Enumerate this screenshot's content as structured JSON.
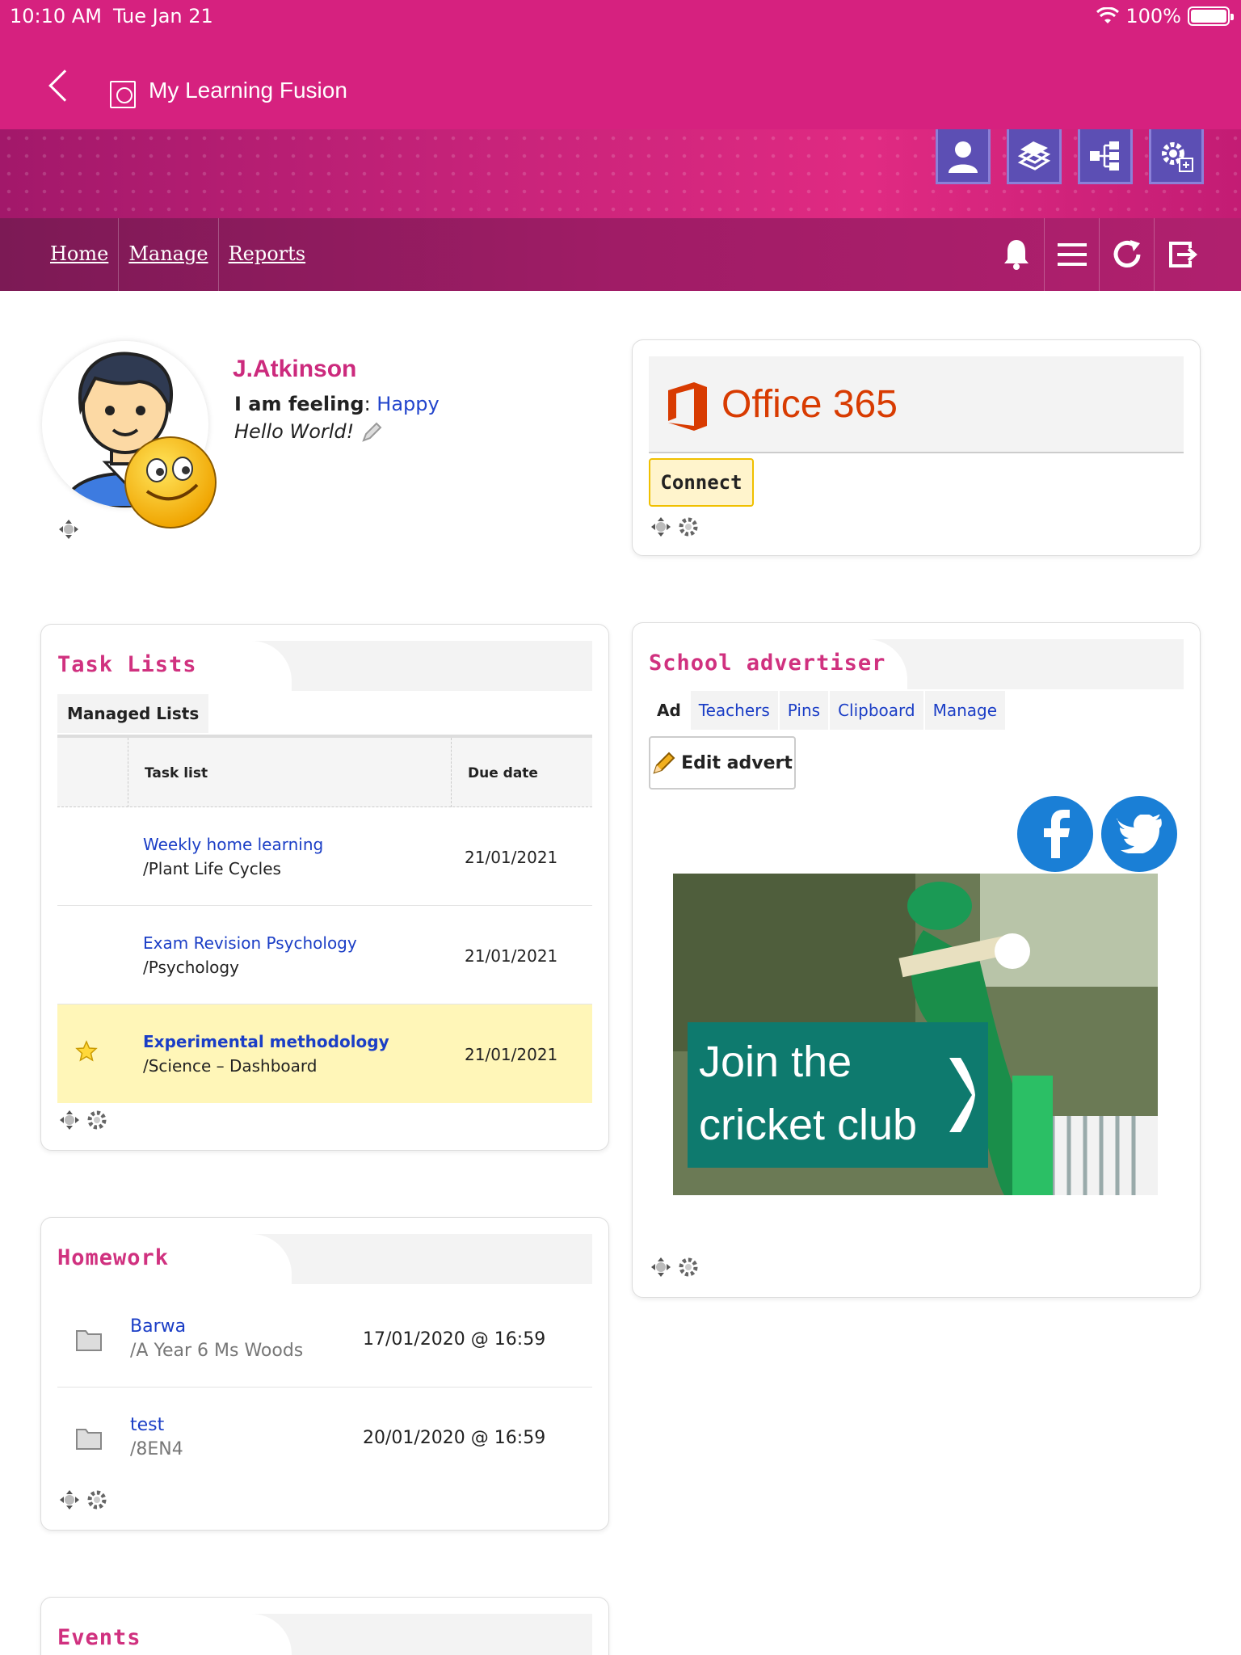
{
  "status_bar": {
    "time": "10:10 AM",
    "date": "Tue Jan 21",
    "battery": "100%"
  },
  "app": {
    "title": "My Learning Fusion"
  },
  "nav": {
    "links": [
      "Home",
      "Manage",
      "Reports"
    ]
  },
  "top_buttons": [
    "user-icon",
    "books-icon",
    "hierarchy-icon",
    "settings-icon"
  ],
  "nav_icons": [
    "bell-icon",
    "menu-icon",
    "refresh-icon",
    "logout-icon"
  ],
  "profile": {
    "name": "J.Atkinson",
    "feeling_label": "I am feeling",
    "feeling_value": "Happy",
    "status": "Hello World!"
  },
  "office": {
    "brand": "Office 365",
    "connect_label": "Connect"
  },
  "task_lists": {
    "title": "Task Lists",
    "subtab": "Managed Lists",
    "columns": [
      "Task list",
      "Due date"
    ],
    "rows": [
      {
        "name": "Weekly home learning",
        "path": "/Plant Life Cycles",
        "due": "21/01/2021",
        "starred": false
      },
      {
        "name": "Exam Revision Psychology",
        "path": "/Psychology",
        "due": "21/01/2021",
        "starred": false
      },
      {
        "name": "Experimental methodology",
        "path": "/Science – Dashboard",
        "due": "21/01/2021",
        "starred": true
      }
    ]
  },
  "advertiser": {
    "title": "School advertiser",
    "tabs": [
      "Ad",
      "Teachers",
      "Pins",
      "Clipboard",
      "Manage"
    ],
    "active_tab": "Ad",
    "edit_label": "Edit advert",
    "ad_text_line1": "Join the",
    "ad_text_line2": "cricket club"
  },
  "homework": {
    "title": "Homework",
    "rows": [
      {
        "name": "Barwa",
        "path": "/A Year 6 Ms Woods",
        "due": "17/01/2020 @ 16:59"
      },
      {
        "name": "test",
        "path": "/8EN4",
        "due": "20/01/2020 @ 16:59"
      }
    ]
  },
  "events": {
    "title": "Events"
  },
  "colors": {
    "brand": "#d6217f",
    "accent": "#cc2a7d",
    "link": "#1b3ec6",
    "highlight": "#fff6b8"
  }
}
